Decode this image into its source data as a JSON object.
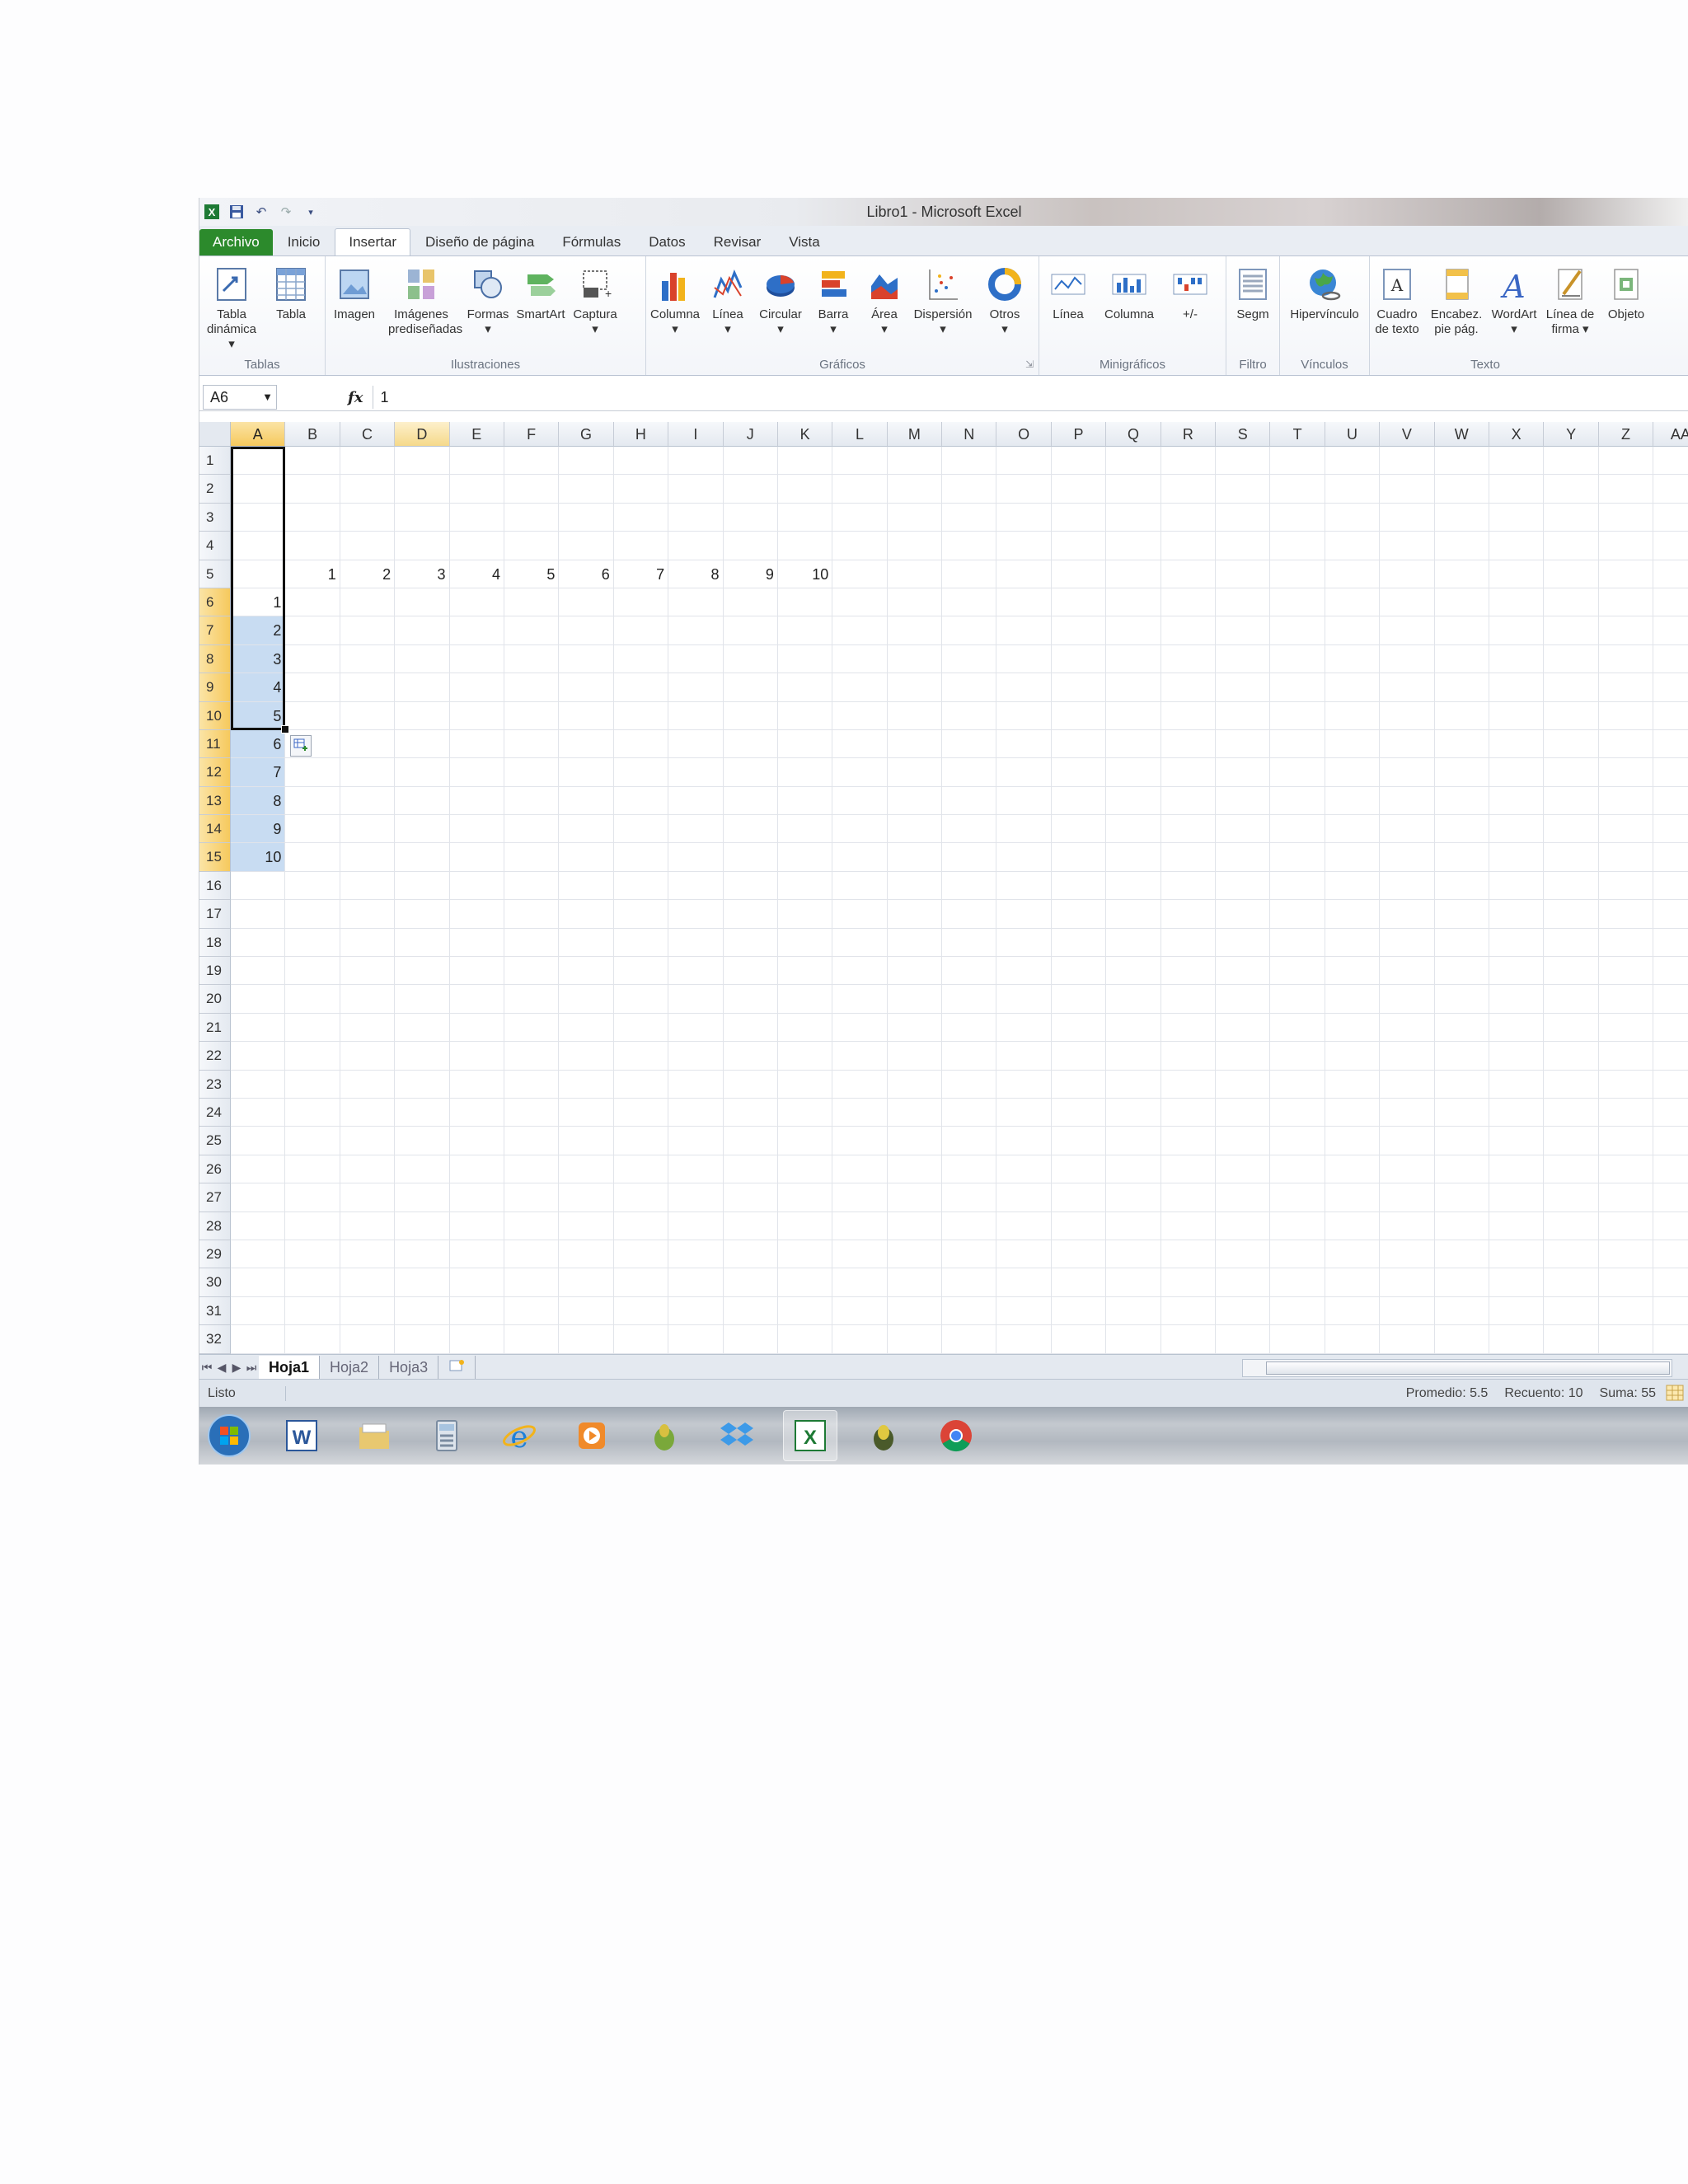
{
  "window": {
    "title": "Libro1  -  Microsoft Excel"
  },
  "tabs": [
    "Archivo",
    "Inicio",
    "Insertar",
    "Diseño de página",
    "Fórmulas",
    "Datos",
    "Revisar",
    "Vista"
  ],
  "active_tab": "Insertar",
  "ribbon": {
    "groups": [
      {
        "label": "Tablas",
        "buttons": [
          "Tabla\ndinámica ▾",
          "Tabla"
        ]
      },
      {
        "label": "Ilustraciones",
        "buttons": [
          "Imagen",
          "Imágenes\nprediseñadas",
          "Formas\n▾",
          "SmartArt",
          "Captura\n▾"
        ]
      },
      {
        "label": "Gráficos",
        "buttons": [
          "Columna\n▾",
          "Línea\n▾",
          "Circular\n▾",
          "Barra\n▾",
          "Área\n▾",
          "Dispersión\n▾",
          "Otros\n▾"
        ]
      },
      {
        "label": "Minigráficos",
        "buttons": [
          "Línea",
          "Columna",
          "+/-"
        ]
      },
      {
        "label": "Filtro",
        "buttons": [
          "Segm"
        ]
      },
      {
        "label": "Vínculos",
        "buttons": [
          "Hipervínculo"
        ]
      },
      {
        "label": "Texto",
        "buttons": [
          "Cuadro\nde texto",
          "Encabez.\npie pág.",
          "WordArt\n▾",
          "Línea de\nfirma ▾",
          "Objeto"
        ]
      }
    ]
  },
  "formula_bar": {
    "name_box": "A6",
    "fx_label": "fx",
    "formula": "1"
  },
  "columns": [
    "A",
    "B",
    "C",
    "D",
    "E",
    "F",
    "G",
    "H",
    "I",
    "J",
    "K",
    "L",
    "M",
    "N",
    "O",
    "P",
    "Q",
    "R",
    "S",
    "T",
    "U",
    "V",
    "W",
    "X",
    "Y",
    "Z",
    "AA"
  ],
  "row_count": 32,
  "cells": {
    "row5": {
      "B": "1",
      "C": "2",
      "D": "3",
      "E": "4",
      "F": "5",
      "G": "6",
      "H": "7",
      "I": "8",
      "J": "9",
      "K": "10"
    },
    "colA": {
      "6": "1",
      "7": "2",
      "8": "3",
      "9": "4",
      "10": "5",
      "11": "6",
      "12": "7",
      "13": "8",
      "14": "9",
      "15": "10"
    }
  },
  "selection": {
    "range": "A6:A15"
  },
  "sheets": [
    "Hoja1",
    "Hoja2",
    "Hoja3"
  ],
  "active_sheet": "Hoja1",
  "status": {
    "ready": "Listo",
    "average": "Promedio: 5.5",
    "count": "Recuento: 10",
    "sum": "Suma: 55"
  },
  "taskbar": [
    "start-orb",
    "word",
    "explorer",
    "calculator",
    "internet-explorer",
    "media-player",
    "app-icon",
    "dropbox",
    "excel",
    "app-icon-2",
    "chrome"
  ],
  "colors": {
    "file_tab": "#2c8a2c",
    "selection_fill": "#c8dcf2",
    "header_highlight": "#f6c95d"
  }
}
